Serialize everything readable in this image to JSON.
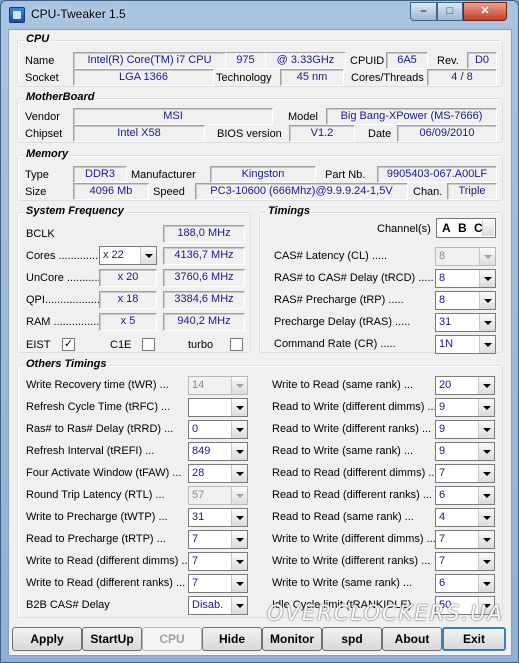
{
  "window": {
    "title": "CPU-Tweaker 1.5",
    "min": "–",
    "max": "□",
    "close": "✕"
  },
  "cpu": {
    "title": "CPU",
    "name_label": "Name",
    "name": "Intel(R) Core(TM) i7 CPU",
    "model": "975",
    "speed": "@ 3.33GHz",
    "cpuid_label": "CPUID",
    "cpuid": "6A5",
    "rev_label": "Rev.",
    "rev": "D0",
    "socket_label": "Socket",
    "socket": "LGA 1366",
    "tech_label": "Technology",
    "tech": "45 nm",
    "cores_label": "Cores/Threads",
    "cores": "4 / 8"
  },
  "motherboard": {
    "title": "MotherBoard",
    "vendor_label": "Vendor",
    "vendor": "MSI",
    "model_label": "Model",
    "model": "Big Bang-XPower (MS-7666)",
    "chipset_label": "Chipset",
    "chipset": "Intel X58",
    "bios_label": "BIOS version",
    "bios": "V1.2",
    "date_label": "Date",
    "date": "06/09/2010"
  },
  "memory": {
    "title": "Memory",
    "type_label": "Type",
    "type": "DDR3",
    "manuf_label": "Manufacturer",
    "manuf": "Kingston",
    "part_label": "Part Nb.",
    "part": "9905403-067.A00LF",
    "size_label": "Size",
    "size": "4096 Mb",
    "speed_label": "Speed",
    "speed": "PC3-10600 (666Mhz)@9.9.9.24-1,5V",
    "chan_label": "Chan.",
    "chan": "Triple"
  },
  "sysfreq": {
    "title": "System Frequency",
    "bclk_label": "BCLK",
    "bclk": "188,0 MHz",
    "cores_label": "Cores",
    "cores_mult": "x 22",
    "cores_freq": "4136,7 MHz",
    "uncore_label": "UnCore",
    "uncore_mult": "x 20",
    "uncore_freq": "3760,6 MHz",
    "qpi_label": "QPI",
    "qpi_mult": "x 18",
    "qpi_freq": "3384,6 MHz",
    "ram_label": "RAM",
    "ram_mult": "x 5",
    "ram_freq": "940,2 MHz",
    "eist_label": "EIST",
    "c1e_label": "C1E",
    "turbo_label": "turbo",
    "check": "✓"
  },
  "timings": {
    "title": "Timings",
    "channel_label": "Channel(s)",
    "channel_a": "A",
    "channel_b": "B",
    "channel_c": "C",
    "rows": [
      {
        "label": "CAS# Latency (CL)",
        "value": "8"
      },
      {
        "label": "RAS# to CAS# Delay (tRCD)",
        "value": "8"
      },
      {
        "label": "RAS# Precharge (tRP)",
        "value": "8"
      },
      {
        "label": "Precharge Delay (tRAS)",
        "value": "31"
      },
      {
        "label": "Command Rate (CR)",
        "value": "1N"
      }
    ]
  },
  "others": {
    "title": "Others Timings",
    "left": [
      {
        "label": "Write Recovery time (tWR)",
        "value": "14"
      },
      {
        "label": "Refresh Cycle Time (tRFC)",
        "value": ""
      },
      {
        "label": "Ras# to Ras# Delay (tRRD)",
        "value": "0"
      },
      {
        "label": "Refresh Interval (tREFI)",
        "value": "849"
      },
      {
        "label": "Four Activate Window (tFAW)",
        "value": "28"
      },
      {
        "label": "Round Trip Latency (RTL)",
        "value": "57"
      },
      {
        "label": "Write to Precharge (tWTP)",
        "value": "31"
      },
      {
        "label": "Read to Precharge (tRTP)",
        "value": "7"
      },
      {
        "label": "Write to Read (different dimms)",
        "value": "7"
      },
      {
        "label": "Write to Read (different ranks)",
        "value": "7"
      },
      {
        "label": "B2B CAS# Delay",
        "value": "Disab."
      }
    ],
    "right": [
      {
        "label": "Write to Read (same rank)",
        "value": "20"
      },
      {
        "label": "Read to Write (different dimms)",
        "value": "9"
      },
      {
        "label": "Read to Write (different ranks)",
        "value": "9"
      },
      {
        "label": "Read to Write (same rank)",
        "value": "9"
      },
      {
        "label": "Read to Read (different dimms)",
        "value": "7"
      },
      {
        "label": "Read to Read (different ranks)",
        "value": "6"
      },
      {
        "label": "Read to Read (same rank)",
        "value": "4"
      },
      {
        "label": "Write to Write (different dimms)",
        "value": "7"
      },
      {
        "label": "Write to Write (different ranks)",
        "value": "7"
      },
      {
        "label": "Write to Write (same rank)",
        "value": "6"
      },
      {
        "label": "Idle Cycle limit (tRANKIDLE)",
        "value": "50"
      }
    ]
  },
  "buttons": {
    "apply": "Apply",
    "startup": "StartUp",
    "cpu": "CPU",
    "hide": "Hide",
    "monitor": "Monitor",
    "spd": "spd",
    "about": "About",
    "exit": "Exit"
  },
  "watermark": "OVERCLOCKERS.UA"
}
